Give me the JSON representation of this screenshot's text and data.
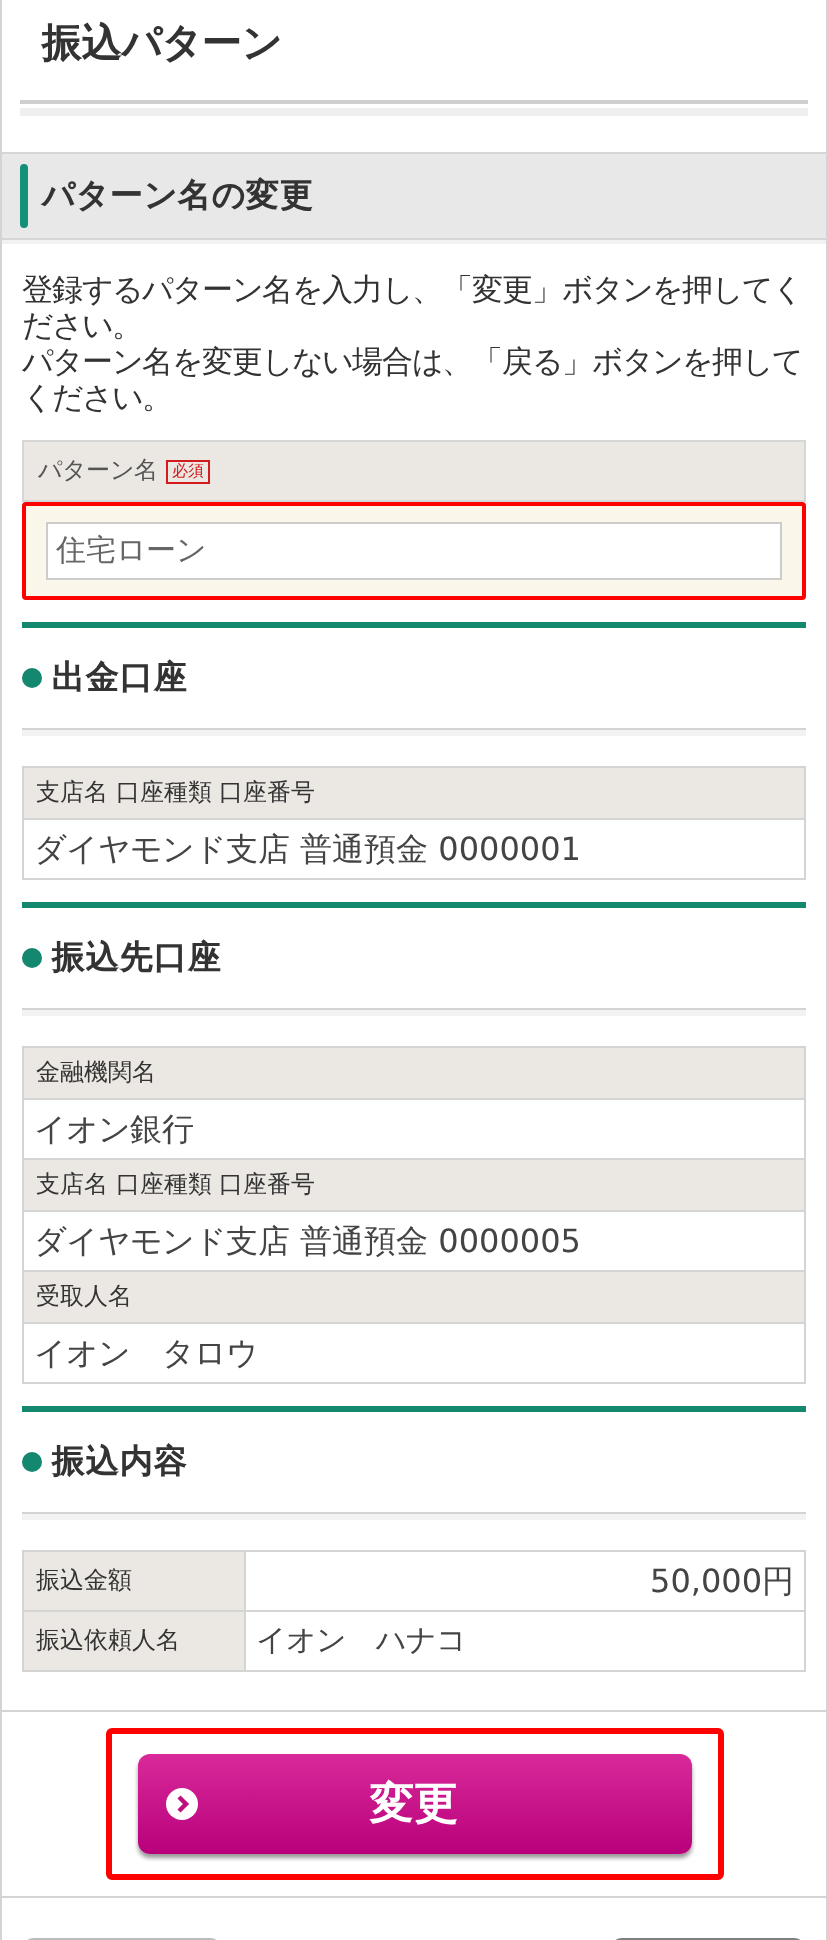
{
  "title": "振込パターン",
  "change_section": {
    "heading": "パターン名の変更",
    "instructions": [
      "登録するパターン名を入力し、「変更」ボタンを押してください。",
      "パターン名を変更しない場合は、「戻る」ボタンを押してください。"
    ],
    "field": {
      "label": "パターン名",
      "required_badge": "必須",
      "value": "住宅ローン",
      "highlighted": true
    }
  },
  "sections": [
    {
      "heading": "出金口座",
      "kind": "stacked",
      "rows": [
        {
          "label": "支店名 口座種類 口座番号",
          "value": "ダイヤモンド支店 普通預金 0000001",
          "kind": "text"
        }
      ]
    },
    {
      "heading": "振込先口座",
      "kind": "stacked",
      "rows": [
        {
          "label": "金融機関名",
          "value": "イオン銀行",
          "kind": "text"
        },
        {
          "label": "支店名 口座種類 口座番号",
          "value": "ダイヤモンド支店 普通預金 0000005",
          "kind": "text"
        },
        {
          "label": "受取人名",
          "value": "イオン　タロウ",
          "kind": "text"
        }
      ]
    },
    {
      "heading": "振込内容",
      "kind": "side",
      "rows": [
        {
          "label": "振込金額",
          "value": "50,000円",
          "kind": "amount"
        },
        {
          "label": "振込依頼人名",
          "value": "イオン　ハナコ",
          "kind": "text"
        }
      ]
    }
  ],
  "submit_button": {
    "label": "変更",
    "highlighted": true
  }
}
